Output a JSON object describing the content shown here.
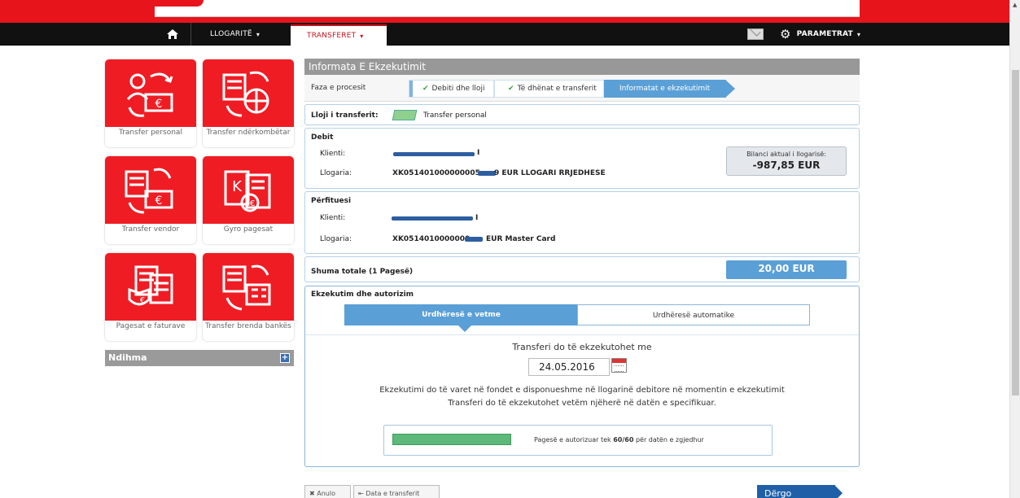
{
  "nav": {
    "accounts": "LLOGARITË",
    "transfers": "TRANSFERET",
    "settings": "PARAMETRAT",
    "caret": "▾"
  },
  "tiles": [
    {
      "label": "Transfer personal"
    },
    {
      "label": "Transfer ndërkombëtar"
    },
    {
      "label": "Transfer vendor"
    },
    {
      "label": "Gyro pagesat"
    },
    {
      "label": "Pagesat e faturave"
    },
    {
      "label": "Transfer brenda bankës"
    }
  ],
  "help": {
    "label": "Ndihma",
    "plus": "+"
  },
  "main": {
    "title": "Informata E Ekzekutimit",
    "process_label": "Faza e procesit",
    "steps": [
      {
        "label": "Debiti dhe lloji",
        "check": "✔"
      },
      {
        "label": "Të dhënat e transferit",
        "check": "✔"
      },
      {
        "label": "Informatat e ekzekutimit"
      }
    ],
    "transfer_type_label": "Lloji i transferit:",
    "transfer_type_value": "Transfer personal",
    "debit": {
      "title": "Debit",
      "client_label": "Klienti:",
      "client_suffix": "I",
      "account_label": "Llogaria:",
      "account_prefix": "XK051401000000005",
      "account_suffix": "9 EUR LLOGARI RRJEDHESE",
      "balance_label": "Bilanci aktual i llogarisë:",
      "balance_value": "-987,85 EUR"
    },
    "beneficiary": {
      "title": "Përfituesi",
      "client_label": "Klienti:",
      "client_suffix": "I",
      "account_label": "Llogaria:",
      "account_prefix": "XK0514010000000",
      "account_suffix": "EUR Master Card"
    },
    "total_label": "Shuma totale (1 Pagesë)",
    "total_value": "20,00 EUR",
    "exec": {
      "title": "Ekzekutim dhe autorizim",
      "tab_single": "Urdhëresë e vetme",
      "tab_auto": "Urdhëresë automatike",
      "when_label": "Transferi do të ekzekutohet me",
      "date": "24.05.2016",
      "note1": "Ekzekutimi do të varet në fondet e disponueshme në llogarinë debitore në momentin e ekzekutimit",
      "note2": "Transferi do të ekzekutohet vetëm njëherë në datën e specifikuar.",
      "auth_prefix": "Pagesë e autorizuar tek",
      "auth_count": "60/60",
      "auth_suffix": "për datën e zgjedhur",
      "auth_progress": 1.0
    }
  },
  "buttons": {
    "cancel": "✖ Anulo",
    "transfer_date": "⇤ Data e transferit",
    "send": "Dërgo transferin"
  },
  "colors": {
    "brand_red": "#ef1c24",
    "accent_blue": "#5a9fd6",
    "send_blue": "#1f5fa8"
  }
}
